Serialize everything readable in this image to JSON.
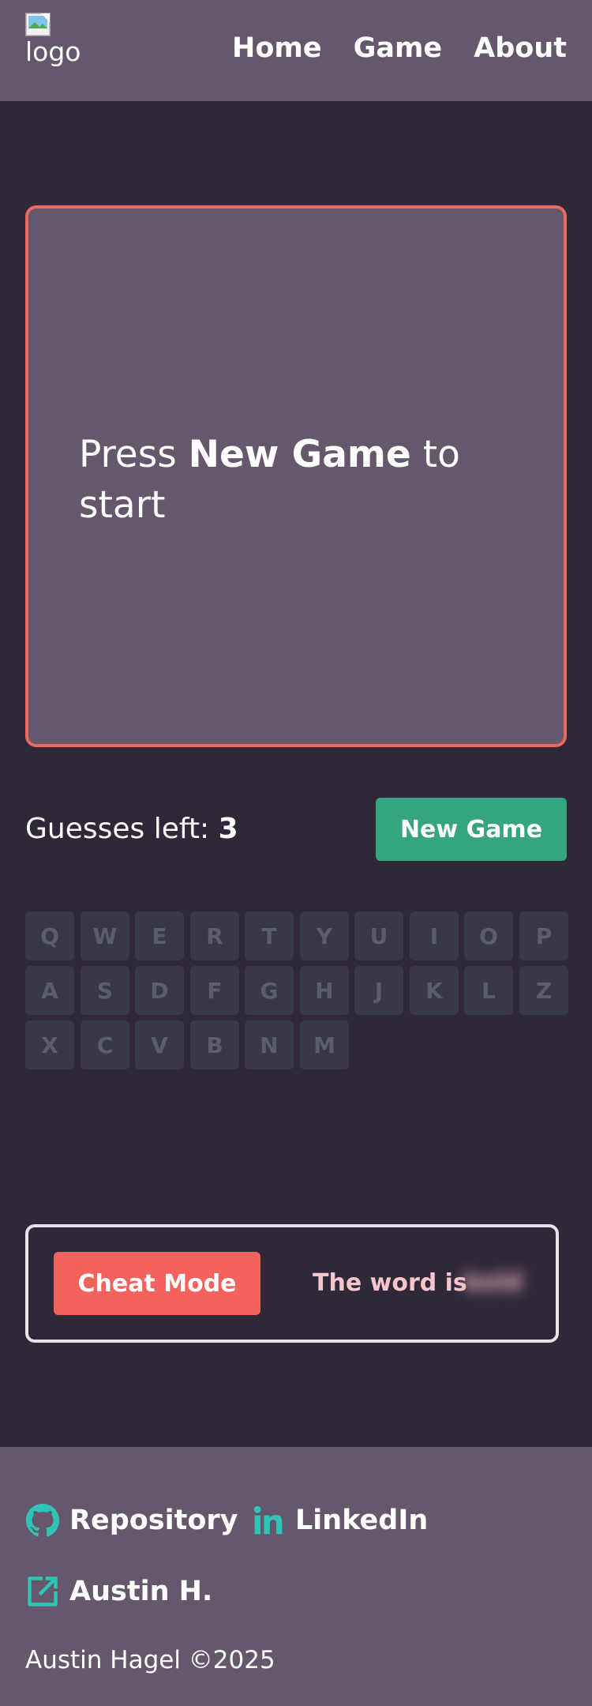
{
  "header": {
    "logo_alt": "logo",
    "nav": [
      "Home",
      "Game",
      "About"
    ]
  },
  "board": {
    "prompt_pre": "Press ",
    "prompt_bold": "New Game",
    "prompt_post": " to start"
  },
  "controls": {
    "guesses_label": "Guesses left: ",
    "guesses_value": "3",
    "new_game_label": "New Game"
  },
  "keyboard": {
    "rows": [
      [
        "Q",
        "W",
        "E",
        "R",
        "T",
        "Y",
        "U",
        "I",
        "O",
        "P"
      ],
      [
        "A",
        "S",
        "D",
        "F",
        "G",
        "H",
        "J",
        "K",
        "L",
        "Z"
      ],
      [
        "X",
        "C",
        "V",
        "B",
        "N",
        "M"
      ]
    ]
  },
  "cheat": {
    "button_label": "Cheat Mode",
    "word_label": "The word is",
    "word_hidden": "bold"
  },
  "footer": {
    "repo_label": "Repository",
    "linkedin_label": "LinkedIn",
    "author_label": "Austin H.",
    "copyright": "Austin Hagel ©2025"
  },
  "colors": {
    "header_bg": "#65586c",
    "page_bg": "#2f2838",
    "board_border": "#eb6a5f",
    "new_game": "#35a581",
    "cheat": "#f4625d",
    "icon_teal": "#2ec4b6"
  }
}
